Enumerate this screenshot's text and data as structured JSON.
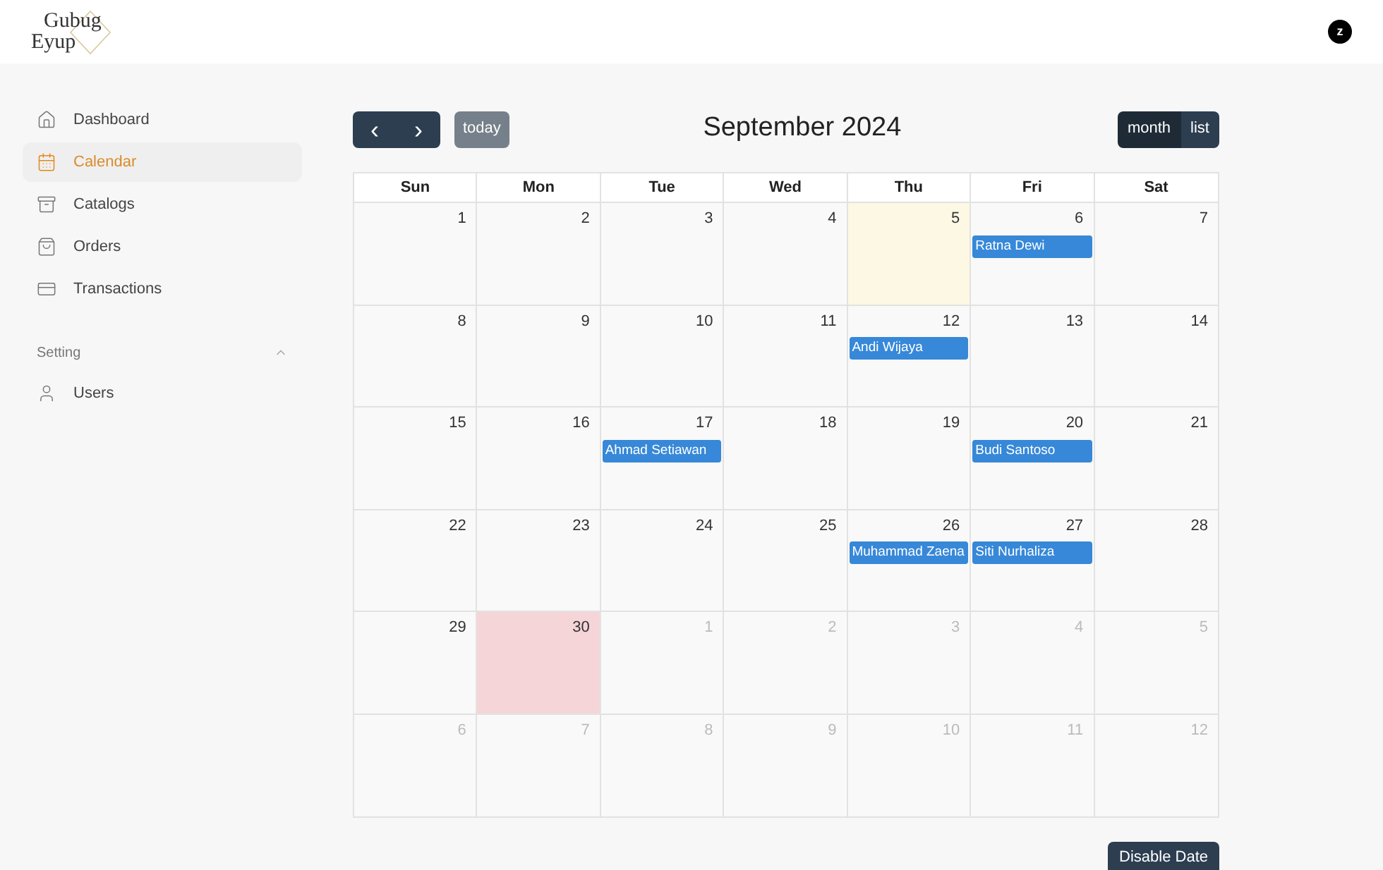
{
  "logo": {
    "line_1": "Gubug",
    "line_2": "Eyup"
  },
  "user": {
    "initial": "z"
  },
  "sidebar": {
    "items": [
      {
        "label": "Dashboard",
        "kind": "home",
        "selected": false
      },
      {
        "label": "Calendar",
        "kind": "calendar",
        "selected": true
      },
      {
        "label": "Catalogs",
        "kind": "box",
        "selected": false
      },
      {
        "label": "Orders",
        "kind": "bag",
        "selected": false
      },
      {
        "label": "Transactions",
        "kind": "card",
        "selected": false
      }
    ],
    "sections": [
      {
        "title": "Setting",
        "expanded": true,
        "items": [
          {
            "label": "Users",
            "kind": "user",
            "selected": false
          }
        ]
      }
    ]
  },
  "toolbar": {
    "prev": "‹",
    "next": "›",
    "today": "today",
    "title": "September 2024",
    "views": [
      {
        "label": "month",
        "selected": true
      },
      {
        "label": "list",
        "selected": false
      }
    ]
  },
  "weekdays": [
    "Sun",
    "Mon",
    "Tue",
    "Wed",
    "Thu",
    "Fri",
    "Sat"
  ],
  "weeks": [
    [
      {
        "day": "1",
        "other_month": false
      },
      {
        "day": "2",
        "other_month": false
      },
      {
        "day": "3",
        "other_month": false
      },
      {
        "day": "4",
        "other_month": false
      },
      {
        "day": "5",
        "other_month": false,
        "today": true
      },
      {
        "day": "6",
        "other_month": false,
        "events": [
          "Ratna Dewi"
        ]
      },
      {
        "day": "7",
        "other_month": false
      }
    ],
    [
      {
        "day": "8",
        "other_month": false
      },
      {
        "day": "9",
        "other_month": false
      },
      {
        "day": "10",
        "other_month": false
      },
      {
        "day": "11",
        "other_month": false
      },
      {
        "day": "12",
        "other_month": false,
        "events": [
          "Andi Wijaya"
        ]
      },
      {
        "day": "13",
        "other_month": false
      },
      {
        "day": "14",
        "other_month": false
      }
    ],
    [
      {
        "day": "15",
        "other_month": false
      },
      {
        "day": "16",
        "other_month": false
      },
      {
        "day": "17",
        "other_month": false,
        "events": [
          "Ahmad Setiawan"
        ]
      },
      {
        "day": "18",
        "other_month": false
      },
      {
        "day": "19",
        "other_month": false
      },
      {
        "day": "20",
        "other_month": false,
        "events": [
          "Budi Santoso"
        ]
      },
      {
        "day": "21",
        "other_month": false
      }
    ],
    [
      {
        "day": "22",
        "other_month": false
      },
      {
        "day": "23",
        "other_month": false
      },
      {
        "day": "24",
        "other_month": false
      },
      {
        "day": "25",
        "other_month": false
      },
      {
        "day": "26",
        "other_month": false,
        "events": [
          "Muhammad Zaena"
        ]
      },
      {
        "day": "27",
        "other_month": false,
        "events": [
          "Siti Nurhaliza"
        ]
      },
      {
        "day": "28",
        "other_month": false
      }
    ],
    [
      {
        "day": "29",
        "other_month": false
      },
      {
        "day": "30",
        "other_month": false,
        "disabled": true
      },
      {
        "day": "1",
        "other_month": true
      },
      {
        "day": "2",
        "other_month": true
      },
      {
        "day": "3",
        "other_month": true
      },
      {
        "day": "4",
        "other_month": true
      },
      {
        "day": "5",
        "other_month": true
      }
    ],
    [
      {
        "day": "6",
        "other_month": true
      },
      {
        "day": "7",
        "other_month": true
      },
      {
        "day": "8",
        "other_month": true
      },
      {
        "day": "9",
        "other_month": true
      },
      {
        "day": "10",
        "other_month": true
      },
      {
        "day": "11",
        "other_month": true
      },
      {
        "day": "12",
        "other_month": true
      }
    ]
  ],
  "disable_button": "Disable Date"
}
